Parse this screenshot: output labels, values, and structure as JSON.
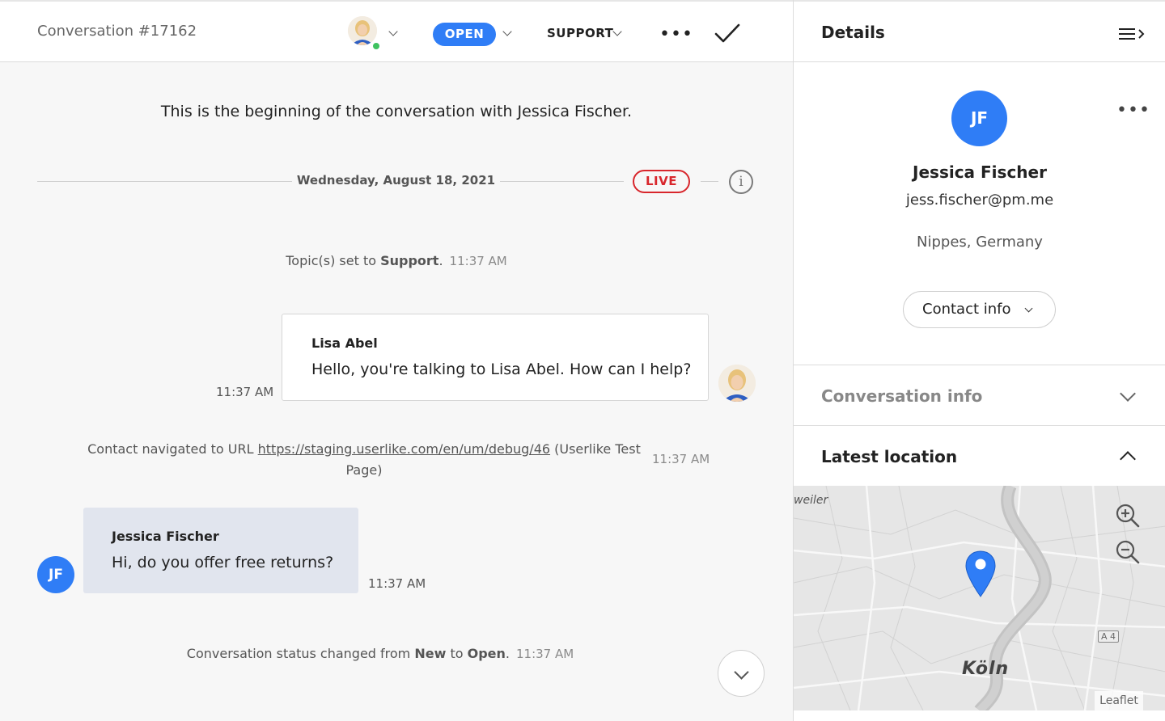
{
  "conversation": {
    "title": "Conversation #17162",
    "status_label": "OPEN",
    "topic_label": "SUPPORT",
    "more_label": "•••",
    "beginning_text": "This is the beginning of the conversation with Jessica Fischer.",
    "date_label": "Wednesday, August 18, 2021",
    "live_label": "LIVE",
    "info_label": "i",
    "events": [
      {
        "prefix": "Topic(s) set to ",
        "bold": "Support",
        "suffix": ".",
        "time": "11:37 AM"
      },
      {
        "prefix": "Contact navigated to URL ",
        "link": "https://staging.userlike.com/en/um/debug/46",
        "suffix": " (Userlike Test Page)",
        "time": "11:37 AM"
      },
      {
        "prefix": "Conversation status changed from ",
        "bold1": "New",
        "mid": " to ",
        "bold2": "Open",
        "suffix": ".",
        "time": "11:37 AM"
      }
    ],
    "messages": [
      {
        "sender": "Lisa Abel",
        "text": "Hello, you're talking to Lisa Abel. How can I help?",
        "time": "11:37 AM"
      },
      {
        "sender": "Jessica Fischer",
        "initials": "JF",
        "text": "Hi, do you offer free returns?",
        "time": "11:37 AM"
      }
    ]
  },
  "details": {
    "title": "Details",
    "contact": {
      "initials": "JF",
      "name": "Jessica Fischer",
      "email": "jess.fischer@pm.me",
      "location": "Nippes, Germany",
      "contact_info_label": "Contact info",
      "more_label": "•••"
    },
    "sections": {
      "conversation_info": "Conversation info",
      "latest_location": "Latest location"
    },
    "map": {
      "city": "Köln",
      "place": "weiler",
      "road": "A 4",
      "attribution": "Leaflet"
    }
  },
  "colors": {
    "accent": "#2f7df6",
    "live": "#d8262c",
    "online": "#3fc25f"
  }
}
